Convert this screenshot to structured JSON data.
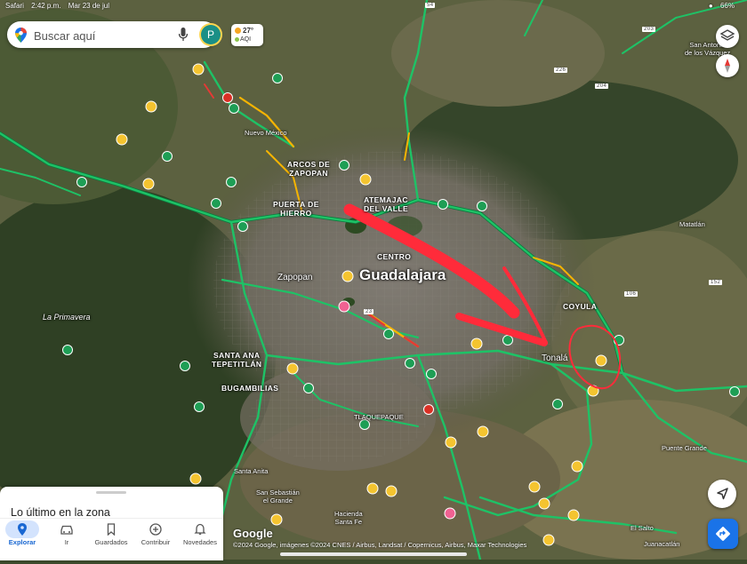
{
  "status_bar": {
    "app": "Safari",
    "time": "2:42 p.m.",
    "date": "Mar 23 de jul",
    "battery": "66%"
  },
  "search": {
    "placeholder": "Buscar aquí",
    "avatar_letter": "P"
  },
  "weather": {
    "temperature": "27°",
    "aqi_label": "AQI"
  },
  "map_labels": {
    "guadalajara": "Guadalajara",
    "zapopan": "Zapopan",
    "tonala": "Tonalá",
    "centro": "CENTRO",
    "atemajac": "ATEMAJAC\nDEL VALLE",
    "arcos": "ARCOS DE\nZAPOPAN",
    "puerta": "PUERTA DE\nHIERRO",
    "santa_ana": "SANTA ANA\nTEPETITLÁN",
    "bugambilias": "BUGAMBILIAS",
    "coyula": "COYULA",
    "nuevo_mexico": "Nuevo México",
    "la_primavera": "La Primavera",
    "tlaquepaque": "TLAQUEPAQUE",
    "santa_anita": "Santa Anita",
    "san_sebastian": "San Sebastián\nel Grande",
    "hacienda": "Hacienda\nSanta Fe",
    "matatlan": "Matatlán",
    "puente_grande": "Puente Grande",
    "el_salto": "El Salto",
    "juanacatlan": "Juanacatlán",
    "san_antonio": "San Antonio\nde los Vázquez",
    "road_203": "203",
    "road_226": "226",
    "road_204": "204",
    "road_106": "106",
    "road_152": "152",
    "road_23": "23",
    "road_54": "54"
  },
  "panel": {
    "title": "Lo último en la zona"
  },
  "tabs": [
    {
      "label": "Explorar",
      "icon": "pin-icon",
      "active": true
    },
    {
      "label": "Ir",
      "icon": "car-icon",
      "active": false
    },
    {
      "label": "Guardados",
      "icon": "bookmark-icon",
      "active": false
    },
    {
      "label": "Contribuir",
      "icon": "plus-circle-icon",
      "active": false
    },
    {
      "label": "Novedades",
      "icon": "bell-icon",
      "active": false
    }
  ],
  "attribution": {
    "logo": "Google",
    "text": "©2024 Google, imágenes ©2024 CNES / Airbus, Landsat / Copernicus, Airbus, Maxar Technologies"
  },
  "colors": {
    "traffic_free": "#1ec266",
    "traffic_slow": "#f5b400",
    "traffic_jam": "#e53935",
    "annotation": "#ff2b3a",
    "accent": "#1a73e8"
  }
}
